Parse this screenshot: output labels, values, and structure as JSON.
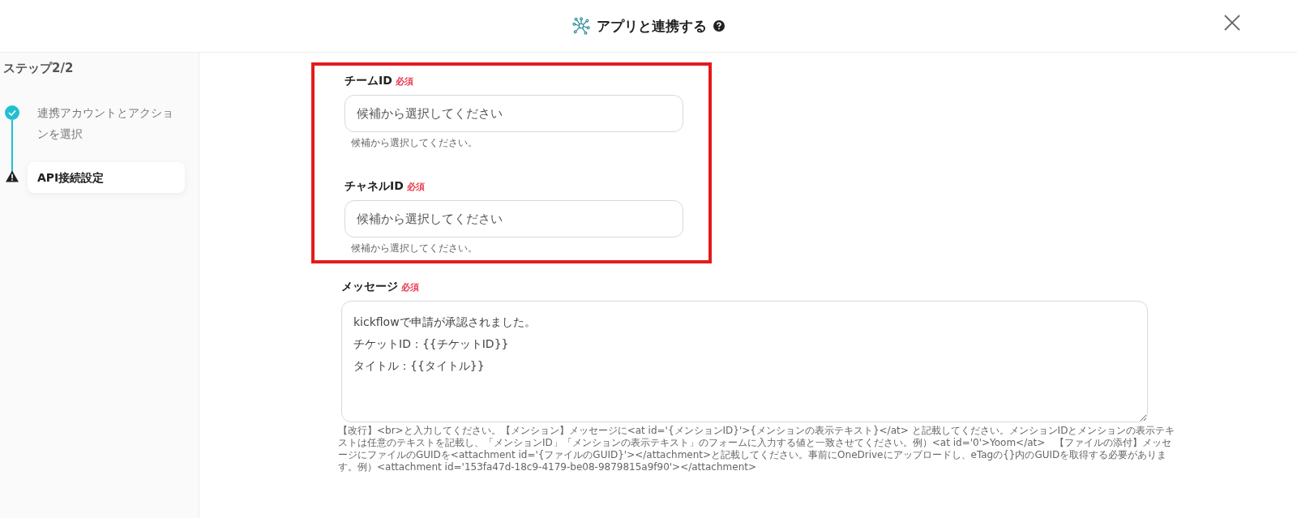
{
  "header": {
    "title": "アプリと連携する"
  },
  "sidebar": {
    "heading": "ステップ2/2",
    "steps": [
      {
        "label": "連携アカウントとアクションを選択",
        "kind": "done",
        "selected": false
      },
      {
        "label": "API接続設定",
        "kind": "warning",
        "selected": true
      }
    ]
  },
  "form": {
    "sections": [
      {
        "highlighted": true,
        "fields": [
          {
            "kind": "select",
            "label": "チームID",
            "required": "必須",
            "placeholder": "候補から選択してください",
            "hint": "候補から選択してください。"
          },
          {
            "kind": "select",
            "label": "チャネルID",
            "required": "必須",
            "placeholder": "候補から選択してください",
            "hint": "候補から選択してください。"
          }
        ]
      },
      {
        "highlighted": false,
        "fields": [
          {
            "kind": "textarea",
            "label": "メッセージ",
            "required": "必須",
            "value_lines": [
              "kickflowで申請が承認されました。",
              "チケットID：{{チケットID}}",
              "タイトル：{{タイトル}}"
            ],
            "hint": "【改行】<br>と入力してください。【メンション】メッセージに<at id='{メンションID}'>{メンションの表示テキスト}</at> と記載してください。メンションIDとメンションの表示テキストは任意のテキストを記載し、「メンションID」「メンションの表示テキスト」のフォームに入力する値と一致させてください。例）<at id='0'>Yoom</at>　【ファイルの添付】メッセージにファイルのGUIDを<attachment id='{ファイルのGUID}'></attachment>と記載してください。事前にOneDriveにアップロードし、eTagの{}内のGUIDを取得する必要があります。例）<attachment id='153fa47d-18c9-4179-be08-9879815a9f90'></attachment>"
          }
        ]
      }
    ]
  }
}
